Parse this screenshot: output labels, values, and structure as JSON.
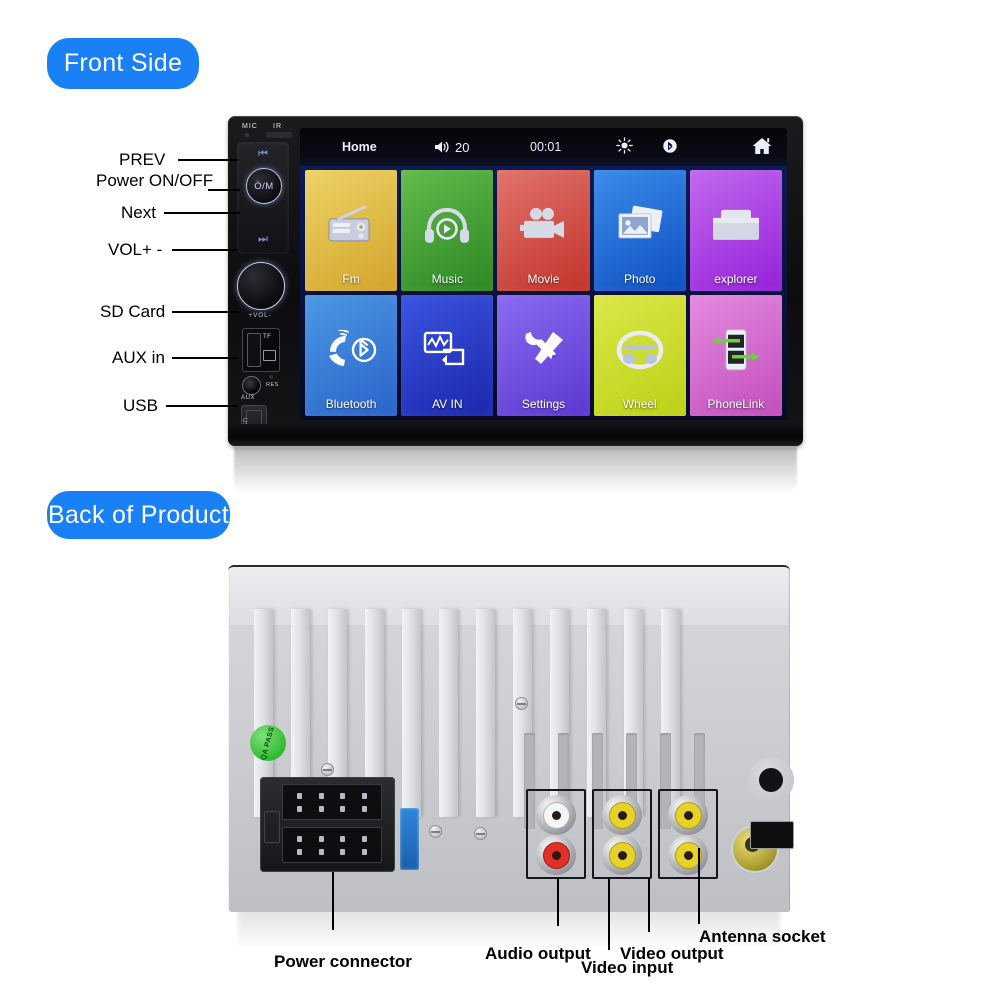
{
  "sections": {
    "front_label": "Front Side",
    "back_label": "Back of Product"
  },
  "front": {
    "bezel": {
      "mic": "MIC",
      "ir": "IR"
    },
    "controls": {
      "prev_glyph": "⏮",
      "power_glyph": "Ò/M",
      "next_glyph": "⏭",
      "vol_mark": "+VOL-",
      "tf_label": "TF",
      "aux_label": "AUX",
      "res_label": "RES",
      "usb_label": "USB"
    },
    "callouts": [
      {
        "text": "PREV"
      },
      {
        "text": "Power ON/OFF"
      },
      {
        "text": "Next"
      },
      {
        "text": "VOL+ -"
      },
      {
        "text": "SD Card"
      },
      {
        "text": "AUX in"
      },
      {
        "text": "USB"
      }
    ],
    "screen": {
      "statusbar": {
        "home_text": "Home",
        "volume_value": "20",
        "volume_icon": "speaker-icon",
        "time": "00:01",
        "brightness_icon": "brightness-icon",
        "bluetooth_icon": "bluetooth-icon",
        "home_icon": "home-icon"
      },
      "apps": [
        {
          "label": "Fm",
          "icon": "radio-icon",
          "color_from": "#e8c84e",
          "color_to": "#d7a82a"
        },
        {
          "label": "Music",
          "icon": "headphones-icon",
          "color_from": "#4fae3e",
          "color_to": "#2f8a27"
        },
        {
          "label": "Movie",
          "icon": "camcorder-icon",
          "color_from": "#d9655f",
          "color_to": "#c73a32"
        },
        {
          "label": "Photo",
          "icon": "photos-icon",
          "color_from": "#2f7ee0",
          "color_to": "#1257c4"
        },
        {
          "label": "explorer",
          "icon": "folder-icon",
          "color_from": "#b95ce8",
          "color_to": "#9a25d8"
        },
        {
          "label": "Bluetooth",
          "icon": "phone-bluetooth-icon",
          "color_from": "#3f8fe0",
          "color_to": "#2f6fd0"
        },
        {
          "label": "AV IN",
          "icon": "av-in-icon",
          "color_from": "#2b46d8",
          "color_to": "#1f30b4"
        },
        {
          "label": "Settings",
          "icon": "tools-icon",
          "color_from": "#7a5ee8",
          "color_to": "#5f3fd8"
        },
        {
          "label": "Wheel",
          "icon": "steering-wheel-icon",
          "color_from": "#d2e03a",
          "color_to": "#c0d221"
        },
        {
          "label": "PhoneLink",
          "icon": "phonelink-icon",
          "color_from": "#d97ad6",
          "color_to": "#c457c0"
        }
      ]
    }
  },
  "back": {
    "qa_sticker": "QA PASS",
    "callouts": [
      {
        "text": "Power connector"
      },
      {
        "text": "Audio output"
      },
      {
        "text": "Video input"
      },
      {
        "text": "Video output"
      },
      {
        "text": "Antenna socket"
      }
    ]
  },
  "colors": {
    "accent_blue": "#1a80f5",
    "background": "#ffffff"
  }
}
